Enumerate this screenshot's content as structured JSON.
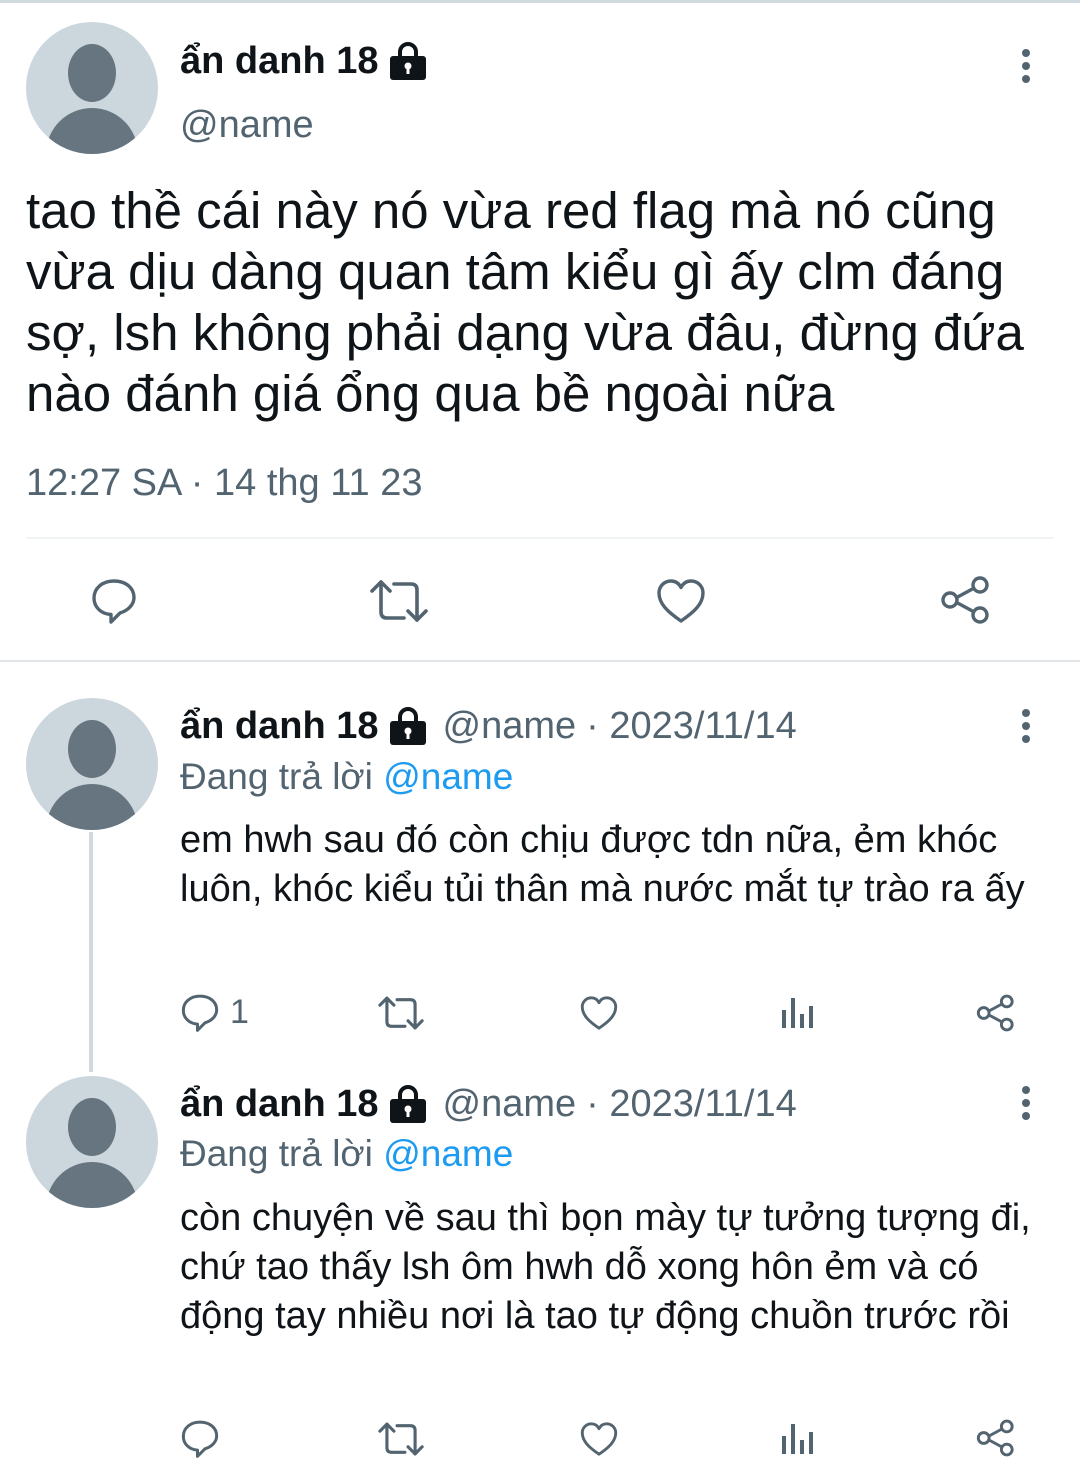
{
  "main_tweet": {
    "display_name": "ẩn danh 18",
    "handle": "@name",
    "text": "tao thề cái này nó vừa red flag mà nó cũng vừa dịu dàng quan tâm kiểu gì ấy clm đáng sợ, lsh không phải dạng vừa đâu, đừng đứa nào đánh giá ổng qua bề ngoài nữa",
    "timestamp": "12:27 SA · 14 thg 11 23",
    "icons": [
      "reply-icon",
      "retweet-icon",
      "like-icon",
      "share-icon"
    ]
  },
  "replies": [
    {
      "display_name": "ẩn danh 18",
      "handle": "@name",
      "date": "· 2023/11/14",
      "replying_prefix": "Đang trả lời",
      "replying_to": "@name",
      "text": "em hwh sau đó còn chịu được tdn nữa, ẻm khóc luôn, khóc kiểu tủi thân mà nước mắt tự trào ra ấy",
      "reply_count": "1"
    },
    {
      "display_name": "ẩn danh 18",
      "handle": "@name",
      "date": "· 2023/11/14",
      "replying_prefix": "Đang trả lời",
      "replying_to": "@name",
      "text": "còn chuyện về sau thì bọn mày tự tưởng tượng đi, chứ tao thấy lsh ôm hwh dỗ xong hôn ẻm và có động tay nhiều nơi là tao tự động chuồn trước rồi",
      "reply_count": ""
    }
  ],
  "colors": {
    "text": "#0f1419",
    "muted": "#536471",
    "link": "#1d9bf0",
    "avatar_bg": "#ccd6dd",
    "avatar_fg": "#66757f"
  }
}
